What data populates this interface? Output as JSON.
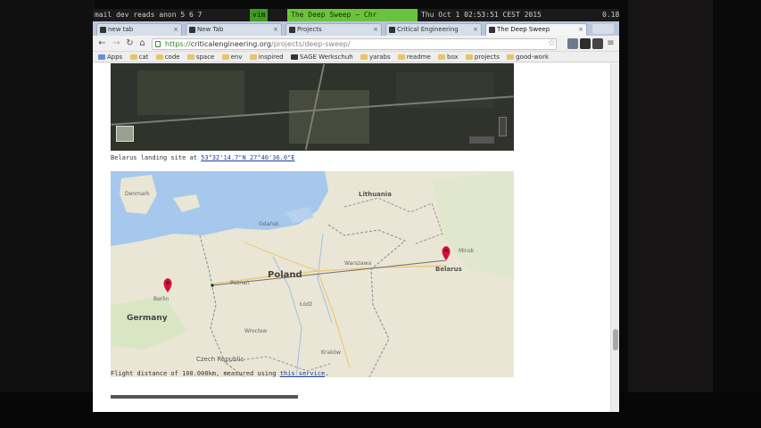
{
  "system_bar": {
    "items": "mail  dev  reads  anon  5  6  7",
    "active_workspace": "vim",
    "window_title": "The Deep Sweep ~ Chr",
    "datetime": "Thu Oct  1 02:53:51 CEST 2015",
    "battery": "0.18"
  },
  "tabs": [
    {
      "label": "new tab"
    },
    {
      "label": "New Tab"
    },
    {
      "label": "Projects"
    },
    {
      "label": "Critical Engineering"
    },
    {
      "label": "The Deep Sweep"
    }
  ],
  "address_bar": {
    "scheme": "https://",
    "host": "criticalengineering.org",
    "path": "/projects/deep-sweep/"
  },
  "bookmarks": [
    "Apps",
    "cat",
    "code",
    "space",
    "env",
    "inspired",
    "SAGE Werkschuh",
    "yarabs",
    "readme",
    "box",
    "projects",
    "good-work"
  ],
  "page": {
    "satellite_caption_prefix": "Belarus landing site at",
    "satellite_caption_link": "53°32'14.7\"N 27°40'36.0\"E",
    "flight_caption_prefix": "Flight distance of",
    "flight_distance": "100.000km",
    "flight_caption_middle": ", measured using",
    "flight_caption_link": "this service",
    "flight_caption_suffix": "."
  },
  "map": {
    "countries": [
      "Poland",
      "Lithuania",
      "Belarus",
      "Germany",
      "Czech Republic",
      "Denmark"
    ],
    "cities": [
      "Warszawa",
      "Berlin",
      "Minsk",
      "Gdańsk",
      "Łódź",
      "Kraków",
      "Poznań",
      "Wrocław"
    ],
    "colors": {
      "water": "#a6c8ec",
      "land": "#e9e6d5",
      "marker": "#d0103a",
      "route": "#6f6f6f"
    }
  }
}
